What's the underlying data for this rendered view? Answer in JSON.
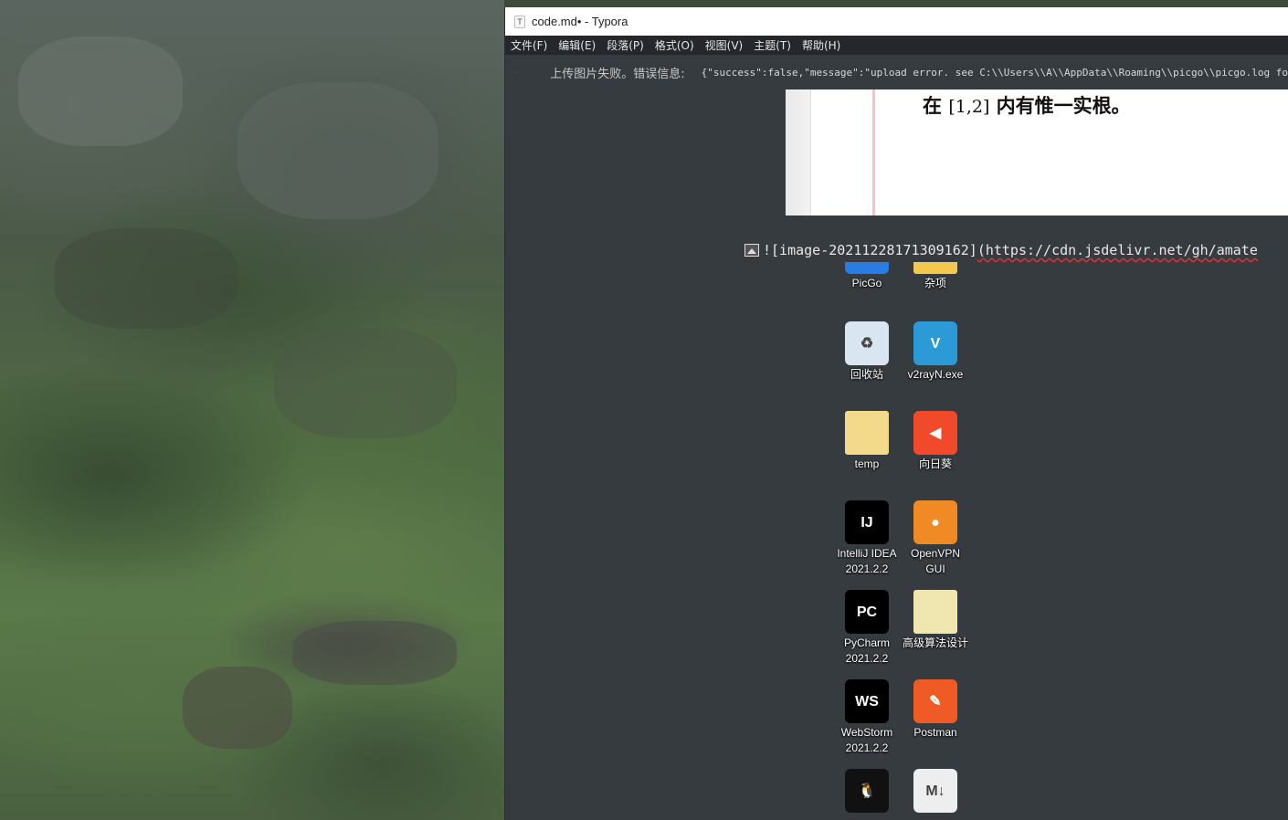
{
  "window": {
    "title": "code.md• - Typora",
    "app_icon_letter": "T"
  },
  "menu": [
    "文件(F)",
    "编辑(E)",
    "段落(P)",
    "格式(O)",
    "视图(V)",
    "主题(T)",
    "帮助(H)"
  ],
  "notice": {
    "message": "上传图片失败。错误信息:",
    "error": "{\"success\":false,\"message\":\"upload error. see C:\\\\Users\\\\A\\\\AppData\\\\Roaming\\\\picgo\\\\picgo.log fo"
  },
  "preview": {
    "text_before": "在",
    "math": "[1,2]",
    "text_after": "内有惟一实根。"
  },
  "markdown_line": {
    "alt": "![image-20211228171309162]",
    "url": "(https://cdn.jsdelivr.net/gh/amate"
  },
  "desktop_icons": [
    {
      "name": "PicGo",
      "icon": "picgo-icon",
      "color": "#2b7be4",
      "glyph": ""
    },
    {
      "name": "杂项",
      "icon": "folder-icon",
      "color": "#f2c94c",
      "glyph": ""
    },
    {
      "name": "回收站",
      "icon": "recycle-bin-icon",
      "color": "#d9e6f2",
      "glyph": "♻"
    },
    {
      "name": "v2rayN.exe",
      "icon": "v2rayn-icon",
      "color": "#2d9ad8",
      "glyph": "V"
    },
    {
      "name": "temp",
      "icon": "folder-icon",
      "color": "#f3d98a",
      "glyph": ""
    },
    {
      "name": "向日葵",
      "icon": "sunlogin-icon",
      "color": "#f04a2a",
      "glyph": "◀"
    },
    {
      "name": "IntelliJ IDEA 2021.2.2",
      "icon": "intellij-icon",
      "color": "#000000",
      "glyph": "IJ"
    },
    {
      "name": "OpenVPN GUI",
      "icon": "openvpn-icon",
      "color": "#f08a24",
      "glyph": "●"
    },
    {
      "name": "PyCharm 2021.2.2",
      "icon": "pycharm-icon",
      "color": "#000000",
      "glyph": "PC"
    },
    {
      "name": "高级算法设计",
      "icon": "document-icon",
      "color": "#f0e6b0",
      "glyph": ""
    },
    {
      "name": "WebStorm 2021.2.2",
      "icon": "webstorm-icon",
      "color": "#000000",
      "glyph": "WS"
    },
    {
      "name": "Postman",
      "icon": "postman-icon",
      "color": "#ef5b25",
      "glyph": "✎"
    },
    {
      "name": "",
      "icon": "qq-icon",
      "color": "#111111",
      "glyph": "🐧"
    },
    {
      "name": "",
      "icon": "markdown-icon",
      "color": "#eeeeee",
      "glyph": "M↓"
    }
  ]
}
